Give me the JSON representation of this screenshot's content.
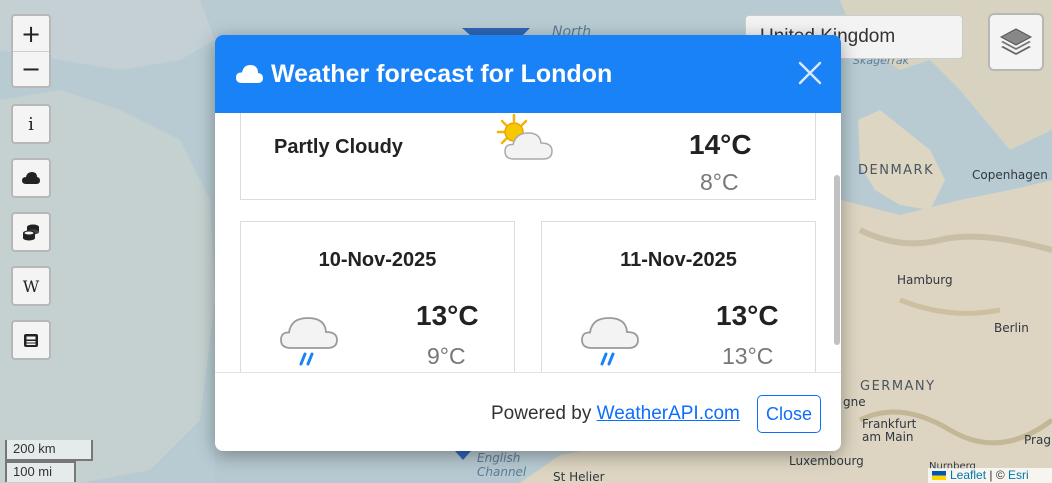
{
  "map": {
    "labels": {
      "north": "North",
      "skagerrak": "Skagerrak",
      "denmark": "DENMARK",
      "copenhagen": "Copenhagen",
      "hamburg": "Hamburg",
      "berlin": "Berlin",
      "germany": "GERMANY",
      "frankfurt": "Frankfurt\nam Main",
      "luxembourg": "Luxembourg",
      "prague": "Prag",
      "english_channel": "English\nChannel",
      "st_helier": "St Helier",
      "gne": "gne",
      "nurnberg": "Nurnberg"
    },
    "country_select": "United Kingdom",
    "scale": {
      "km": "200 km",
      "mi": "100 mi"
    },
    "attribution": {
      "leaflet": "Leaflet",
      "sep": " | © ",
      "esri": "Esri"
    },
    "controls": {
      "zoom_in": "+",
      "zoom_out": "−",
      "info": "i",
      "wiki": "W"
    }
  },
  "modal": {
    "title": "Weather forecast for London",
    "current": {
      "condition": "Partly Cloudy",
      "high": "14°C",
      "low": "8°C"
    },
    "forecast": [
      {
        "date": "10-Nov-2025",
        "high": "13°C",
        "low": "9°C",
        "icon": "light-rain-icon"
      },
      {
        "date": "11-Nov-2025",
        "high": "13°C",
        "low": "13°C",
        "icon": "light-rain-icon"
      }
    ],
    "footer": {
      "powered_by": "Powered by ",
      "link": "WeatherAPI.com",
      "close": "Close"
    }
  },
  "colors": {
    "header": "#1a82f7",
    "link": "#0d6efd",
    "rain": "#1a82f7"
  }
}
